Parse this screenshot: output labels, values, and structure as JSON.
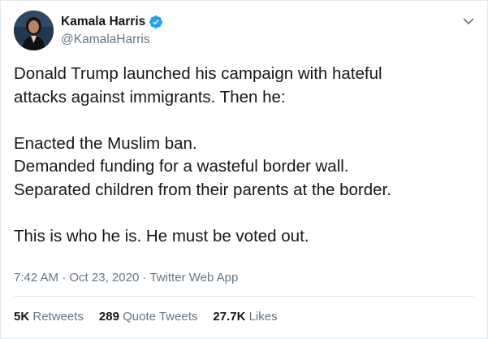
{
  "author": {
    "display_name": "Kamala Harris",
    "handle": "@KamalaHarris",
    "verified_icon": "verified-badge-icon",
    "menu_icon": "chevron-down-icon"
  },
  "tweet": {
    "lines": [
      "Donald Trump launched his campaign with hateful",
      "attacks against immigrants. Then he:",
      "",
      "Enacted the Muslim ban.",
      "Demanded funding for a wasteful border wall.",
      "Separated children from their parents at the border.",
      "",
      "This is who he is. He must be voted out."
    ]
  },
  "meta": {
    "time": "7:42 AM",
    "date": "Oct 23, 2020",
    "source": "Twitter Web App",
    "separator": "·"
  },
  "stats": {
    "retweets_count": "5K",
    "retweets_label": "Retweets",
    "quote_count": "289",
    "quote_label": "Quote Tweets",
    "likes_count": "27.7K",
    "likes_label": "Likes"
  },
  "colors": {
    "text_primary": "#14171a",
    "text_secondary": "#657786",
    "verified_blue": "#1da1f2",
    "border": "#e1e8ed"
  }
}
